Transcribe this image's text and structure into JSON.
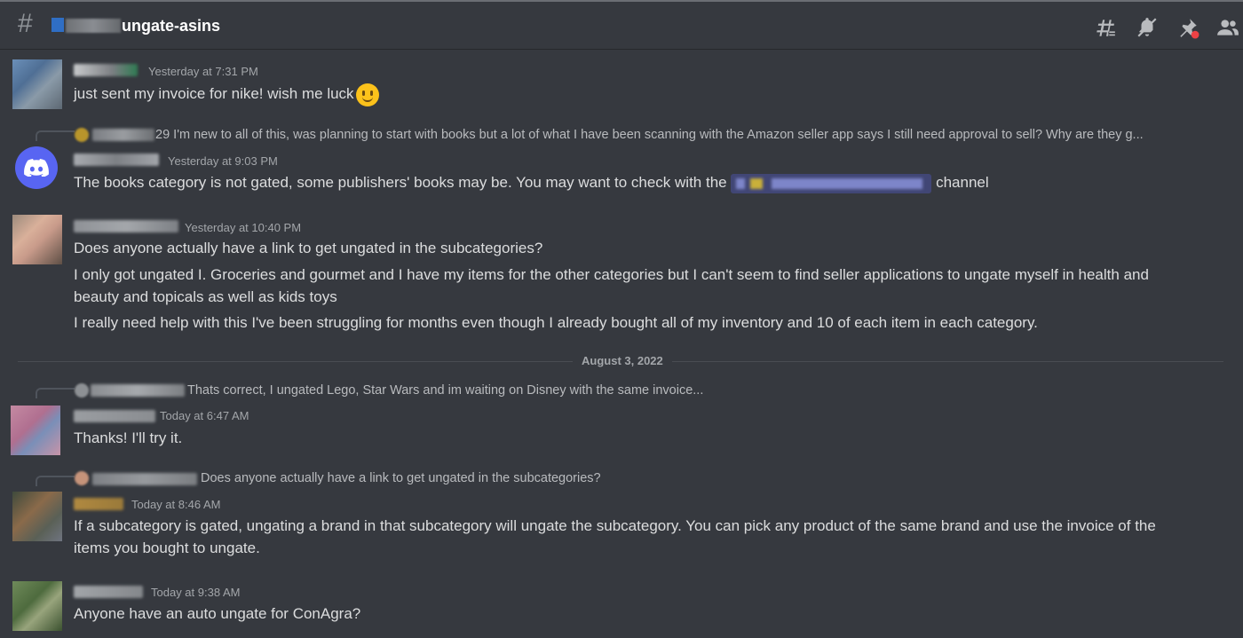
{
  "header": {
    "channel_name": "ungate-asins",
    "icons": [
      "threads-icon",
      "mute-icon",
      "pin-icon",
      "members-icon"
    ]
  },
  "messages": [
    {
      "timestamp": "Yesterday at 7:31 PM",
      "text": "just sent my invoice for nike! wish me luck"
    },
    {
      "reply_name_suffix": "29",
      "reply_text": "I'm new to all of this, was planning to start with books but a lot of what I have been scanning with the Amazon seller app says I still need approval to sell? Why are they g...",
      "timestamp": "Yesterday at 9:03 PM",
      "text_before": "The books category is not gated, some publishers' books may be. You may want to check with the",
      "text_after": "channel"
    },
    {
      "timestamp": "Yesterday at 10:40 PM",
      "lines": [
        "Does anyone actually have a link to get ungated in the subcategories?",
        "I only got ungated I. Groceries and gourmet and I have my items for the other categories but I can't seem to find seller applications to ungate myself in health and beauty and topicals as well as kids toys",
        "I really need help with this I've been struggling for months even though I already bought all of my inventory and 10 of each item in each category."
      ]
    },
    {
      "reply_text": "Thats correct, I ungated Lego, Star Wars and im waiting on Disney with the same invoice...",
      "timestamp": "Today at 6:47 AM",
      "text": "Thanks! I'll try it."
    },
    {
      "reply_text": "Does anyone actually have a link to get ungated in the subcategories?",
      "timestamp": "Today at 8:46 AM",
      "text": "If a subcategory is gated, ungating a brand in that subcategory will ungate the subcategory. You can pick any product of the same brand and use the invoice of the items you bought to ungate."
    },
    {
      "timestamp": "Today at 9:38 AM",
      "text": "Anyone have an auto ungate for ConAgra?"
    }
  ],
  "date_divider": "August 3, 2022"
}
